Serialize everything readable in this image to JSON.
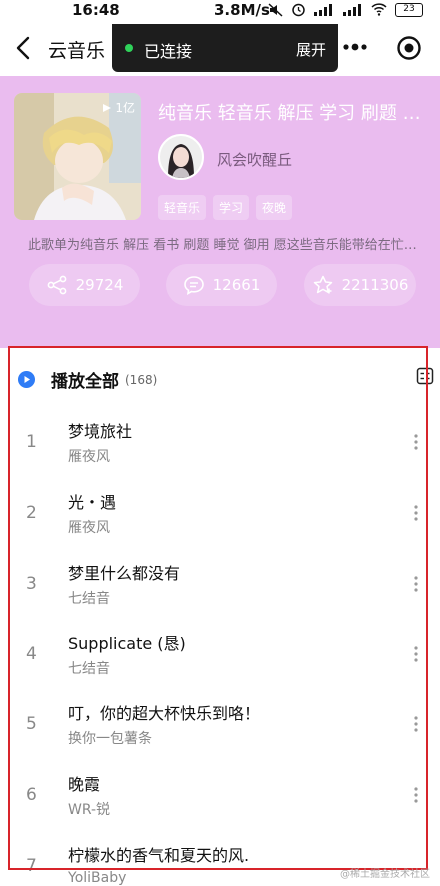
{
  "status_bar": {
    "time": "16:48",
    "speed": "3.8M/s",
    "battery": "23"
  },
  "header": {
    "title": "云音乐",
    "connection_status": "已连接",
    "expand_label": "展开"
  },
  "playlist": {
    "cover_play_count": "1亿",
    "title": "纯音乐 轻音乐 解压 学习 刷题 睡觉",
    "creator": "风会吹醒丘",
    "tags": [
      "轻音乐",
      "学习",
      "夜晚"
    ],
    "description": "此歌单为纯音乐 解压 看书 刷题 睡觉 御用 愿这些音乐能带给在忙碌中的你一丝放松",
    "share_count": "29724",
    "comment_count": "12661",
    "collect_count": "2211306"
  },
  "list": {
    "play_all_label": "播放全部",
    "total_count": "(168)",
    "songs": [
      {
        "num": "1",
        "title": "梦境旅社",
        "artist": "雁夜风"
      },
      {
        "num": "2",
        "title": "光・遇",
        "artist": "雁夜风"
      },
      {
        "num": "3",
        "title": "梦里什么都没有",
        "artist": "七结音"
      },
      {
        "num": "4",
        "title": "Supplicate (恳)",
        "artist": "七结音"
      },
      {
        "num": "5",
        "title": "叮，你的超大杯快乐到咯！",
        "artist": "换你一包薯条"
      },
      {
        "num": "6",
        "title": "晚霞",
        "artist": "WR-锐"
      },
      {
        "num": "7",
        "title": "柠檬水的香气和夏天的风.",
        "artist": "YoliBaby"
      }
    ]
  },
  "watermark": "@稀土掘金技术社区",
  "colors": {
    "header_bg": "#eabcef",
    "accent_blue": "#2f7cf6",
    "outline_red": "#d8242a",
    "connected_green": "#2fd25a"
  }
}
